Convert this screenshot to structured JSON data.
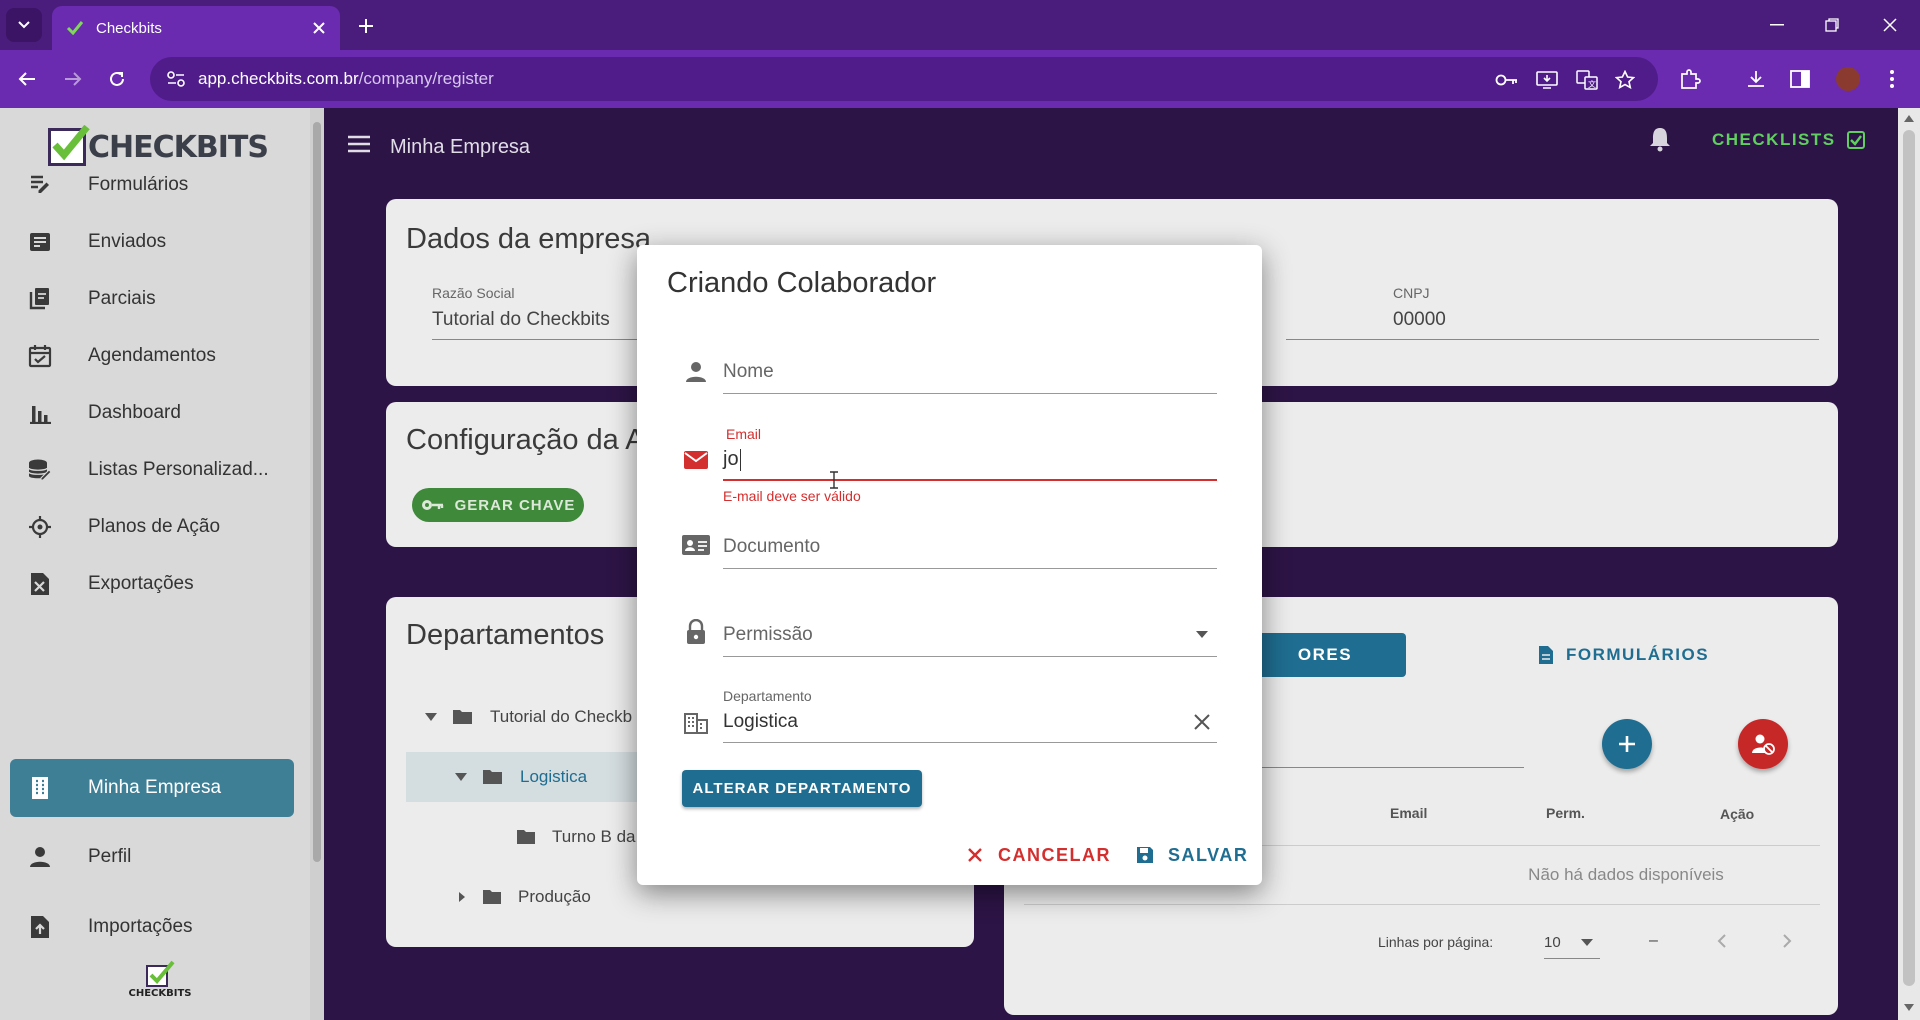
{
  "browser": {
    "tab_title": "Checkbits",
    "url_host": "app.checkbits.com.br",
    "url_path": "/company/register"
  },
  "app": {
    "logo_text": "CHECKBITS",
    "header_title": "Minha Empresa",
    "checklists_label": "CHECKLISTS",
    "bottom_logo_text": "CHECKBITS"
  },
  "sidebar": {
    "items": [
      {
        "label": "Formulários",
        "icon": "form-edit-icon"
      },
      {
        "label": "Enviados",
        "icon": "sent-list-icon"
      },
      {
        "label": "Parciais",
        "icon": "partial-docs-icon"
      },
      {
        "label": "Agendamentos",
        "icon": "calendar-check-icon"
      },
      {
        "label": "Dashboard",
        "icon": "bar-chart-icon"
      },
      {
        "label": "Listas Personalizad...",
        "icon": "database-icon"
      },
      {
        "label": "Planos de Ação",
        "icon": "crosshair-icon"
      },
      {
        "label": "Exportações",
        "icon": "excel-icon"
      },
      {
        "label": "Minha Empresa",
        "icon": "building-icon",
        "active": true
      },
      {
        "label": "Perfil",
        "icon": "person-icon"
      },
      {
        "label": "Importações",
        "icon": "import-icon"
      }
    ]
  },
  "company_card": {
    "title": "Dados da empresa",
    "razao_label": "Razão Social",
    "razao_value": "Tutorial do Checkbits",
    "cnpj_label": "CNPJ",
    "cnpj_value": "00000"
  },
  "config_card": {
    "title": "Configuração da A",
    "button_label": "GERAR CHAVE"
  },
  "departments_card": {
    "title": "Departamentos",
    "tree": [
      {
        "label": "Tutorial do Checkb",
        "level": 0
      },
      {
        "label": "Logistica",
        "level": 1
      },
      {
        "label": "Turno B da",
        "level": 2
      },
      {
        "label": "Produção",
        "level": 1
      }
    ]
  },
  "collab_card": {
    "tab_collab": "ORES",
    "tab_forms": "FORMULÁRIOS",
    "columns": [
      "Email",
      "Perm.",
      "Ação"
    ],
    "empty_text": "Não há dados disponíveis",
    "rows_per_page_label": "Linhas por página:",
    "rows_per_page_value": "10",
    "range_text": "–"
  },
  "dialog": {
    "title": "Criando Colaborador",
    "name_placeholder": "Nome",
    "email_label": "Email",
    "email_value": "jo",
    "email_error": "E-mail deve ser válido",
    "document_placeholder": "Documento",
    "permission_placeholder": "Permissão",
    "department_label": "Departamento",
    "department_value": "Logistica",
    "alter_button": "ALTERAR DEPARTAMENTO",
    "cancel_button": "CANCELAR",
    "save_button": "SALVAR"
  },
  "colors": {
    "accent_teal": "#1f6d90",
    "error_red": "#d32f2f",
    "green": "#3f8a3a",
    "purple_bg": "#2d1446"
  }
}
